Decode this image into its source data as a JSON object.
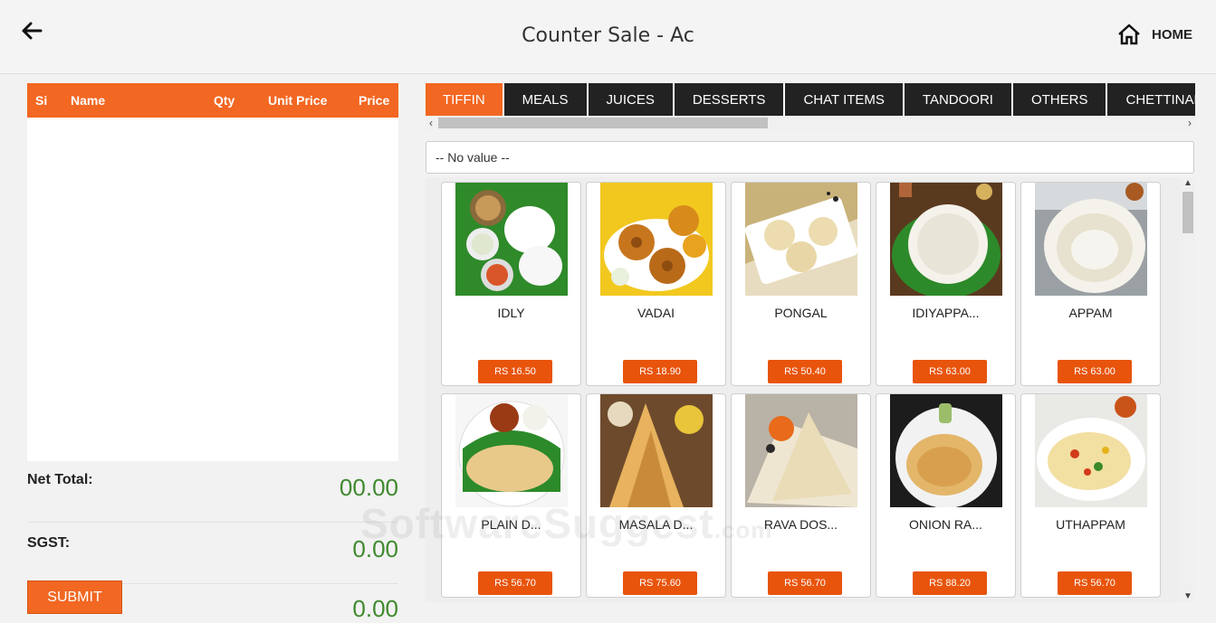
{
  "header": {
    "title": "Counter Sale - Ac",
    "home_label": "HOME"
  },
  "cart": {
    "columns": [
      "Si",
      "Name",
      "Qty",
      "Unit Price",
      "Price"
    ],
    "net_total_label": "Net Total:",
    "net_total_value": "00.00",
    "sgst_label": "SGST:",
    "sgst_value": "0.00",
    "third_value": "0.00",
    "submit_label": "SUBMIT"
  },
  "tabs": [
    "TIFFIN",
    "MEALS",
    "JUICES",
    "DESSERTS",
    "CHAT ITEMS",
    "TANDOORI",
    "OTHERS",
    "CHETTINADU"
  ],
  "active_tab": "TIFFIN",
  "filter": {
    "selected": "-- No value --"
  },
  "items": [
    {
      "name": "IDLY",
      "price": "RS 16.50"
    },
    {
      "name": "VADAI",
      "price": "RS 18.90"
    },
    {
      "name": "PONGAL",
      "price": "RS 50.40"
    },
    {
      "name": "IDIYAPPA...",
      "price": "RS 63.00"
    },
    {
      "name": "APPAM",
      "price": "RS 63.00"
    },
    {
      "name": "PLAIN D...",
      "price": "RS 56.70"
    },
    {
      "name": "MASALA D...",
      "price": "RS 75.60"
    },
    {
      "name": "RAVA DOS...",
      "price": "RS 56.70"
    },
    {
      "name": "ONION RA...",
      "price": "RS 88.20"
    },
    {
      "name": "UTHAPPAM",
      "price": "RS 56.70"
    }
  ],
  "watermark": {
    "main": "SoftwareSuggest",
    "suffix": ".com"
  },
  "colors": {
    "accent": "#f26722",
    "tab_bg": "#222222",
    "total_green": "#3f8a2e"
  }
}
